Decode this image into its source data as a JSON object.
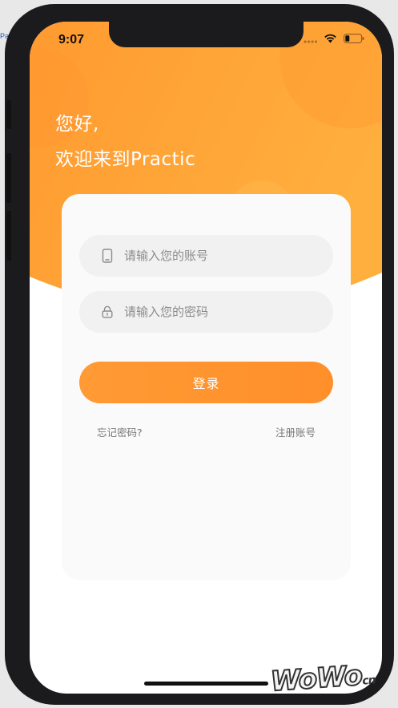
{
  "desktop": {
    "background_text": "Pa"
  },
  "status_bar": {
    "time": "9:07",
    "icons": [
      "signal-icon",
      "wifi-icon",
      "battery-icon"
    ]
  },
  "header": {
    "greeting": "您好,",
    "welcome": "欢迎来到Practic"
  },
  "login_form": {
    "account_placeholder": "请输入您的账号",
    "account_value": "",
    "password_placeholder": "请输入您的密码",
    "password_value": "",
    "login_label": "登录",
    "forgot_password": "忘记密码?",
    "register": "注册账号"
  },
  "watermark": {
    "text": "WoWo",
    "suffix": "cn"
  },
  "colors": {
    "primary_orange": "#ff9a34",
    "header_orange": "#ffa438",
    "card_bg": "#fafafa",
    "input_bg": "#f1f1f1",
    "placeholder_gray": "#8c8c8c",
    "link_gray": "#777777"
  }
}
